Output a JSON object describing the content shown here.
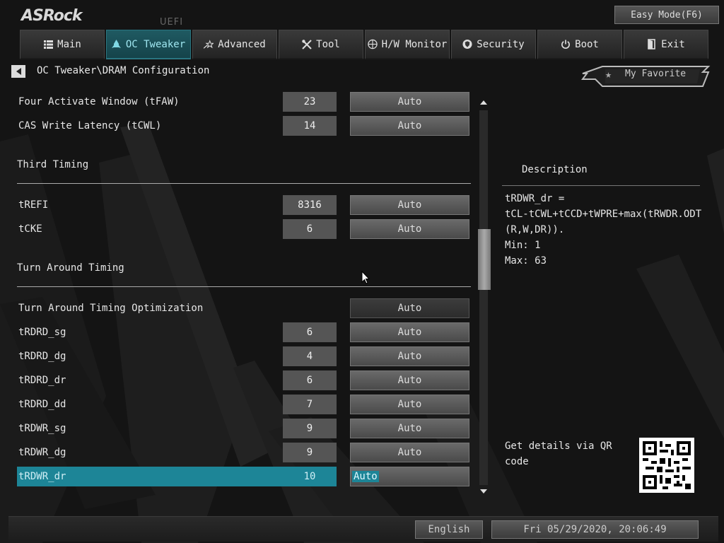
{
  "header": {
    "brand": "ASRock",
    "badge": "UEFI",
    "easy_mode_label": "Easy Mode(F6)"
  },
  "tabs": [
    {
      "label": "Main",
      "icon": "list-icon",
      "active": false
    },
    {
      "label": "OC Tweaker",
      "icon": "rocket-icon",
      "active": true
    },
    {
      "label": "Advanced",
      "icon": "star-arrow-icon",
      "active": false
    },
    {
      "label": "Tool",
      "icon": "tools-icon",
      "active": false
    },
    {
      "label": "H/W Monitor",
      "icon": "monitor-icon",
      "active": false
    },
    {
      "label": "Security",
      "icon": "shield-icon",
      "active": false
    },
    {
      "label": "Boot",
      "icon": "power-icon",
      "active": false
    },
    {
      "label": "Exit",
      "icon": "exit-icon",
      "active": false
    }
  ],
  "breadcrumb": "OC Tweaker\\DRAM Configuration",
  "favorite_label": "My Favorite",
  "settings": {
    "tfaw": {
      "label": "Four Activate Window (tFAW)",
      "value": "23",
      "option": "Auto"
    },
    "tcwl": {
      "label": "CAS Write Latency (tCWL)",
      "value": "14",
      "option": "Auto"
    },
    "third_timing": "Third Timing",
    "trefi": {
      "label": "tREFI",
      "value": "8316",
      "option": "Auto"
    },
    "tcke": {
      "label": "tCKE",
      "value": "6",
      "option": "Auto"
    },
    "turn_around": "Turn Around Timing",
    "tat_opt": {
      "label": "Turn Around Timing Optimization",
      "option": "Auto"
    },
    "trdrd_sg": {
      "label": "tRDRD_sg",
      "value": "6",
      "option": "Auto"
    },
    "trdrd_dg": {
      "label": "tRDRD_dg",
      "value": "4",
      "option": "Auto"
    },
    "trdrd_dr": {
      "label": "tRDRD_dr",
      "value": "6",
      "option": "Auto"
    },
    "trdrd_dd": {
      "label": "tRDRD_dd",
      "value": "7",
      "option": "Auto"
    },
    "trdwr_sg": {
      "label": "tRDWR_sg",
      "value": "9",
      "option": "Auto"
    },
    "trdwr_dg": {
      "label": "tRDWR_dg",
      "value": "9",
      "option": "Auto"
    },
    "trdwr_dr": {
      "label": "tRDWR_dr",
      "value": "10",
      "option": "Auto"
    }
  },
  "description": {
    "title": "Description",
    "text": "tRDWR_dr =\ntCL-tCWL+tCCD+tWPRE+max(tRWDR.ODT\n(R,W,DR)).\nMin: 1\nMax: 63",
    "qr_text": "Get details via QR code"
  },
  "footer": {
    "language": "English",
    "datetime": "Fri 05/29/2020, 20:06:49"
  },
  "colors": {
    "accent": "#1d8597",
    "active_tab": "#1f5a62"
  }
}
